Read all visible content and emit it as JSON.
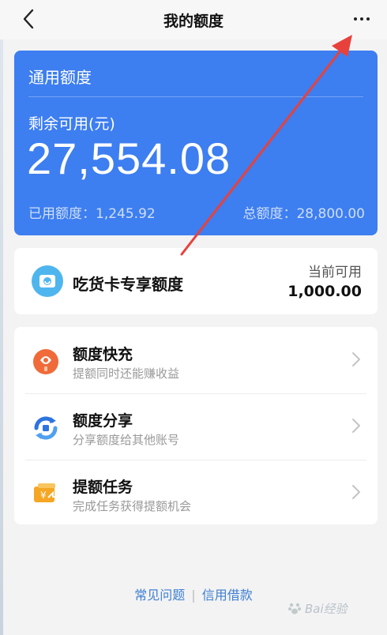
{
  "nav": {
    "title": "我的额度",
    "back_icon": "chevron-left-icon",
    "more_icon": "more-dots-icon"
  },
  "quota_card": {
    "title": "通用额度",
    "remaining_label": "剩余可用(元)",
    "remaining_amount": "27,554.08",
    "used_label": "已用额度：",
    "used_value": "1,245.92",
    "total_label": "总额度：",
    "total_value": "28,800.00",
    "background_color": "#3d7ef0"
  },
  "foodie_card": {
    "title": "吃货卡专享额度",
    "available_label": "当前可用",
    "available_value": "1,000.00",
    "icon": "foodie-card-icon"
  },
  "menu": {
    "items": [
      {
        "title": "额度快充",
        "subtitle": "提额同时还能赚收益",
        "icon": "quota-recharge-icon"
      },
      {
        "title": "额度分享",
        "subtitle": "分享额度给其他账号",
        "icon": "quota-share-icon"
      },
      {
        "title": "提额任务",
        "subtitle": "完成任务获得提额机会",
        "icon": "quota-task-icon"
      }
    ]
  },
  "footer": {
    "faq": "常见问题",
    "separator": "|",
    "credit_loan": "信用借款"
  },
  "watermark": {
    "text": "Bai经验"
  },
  "annotation": {
    "color": "#e8413b"
  }
}
